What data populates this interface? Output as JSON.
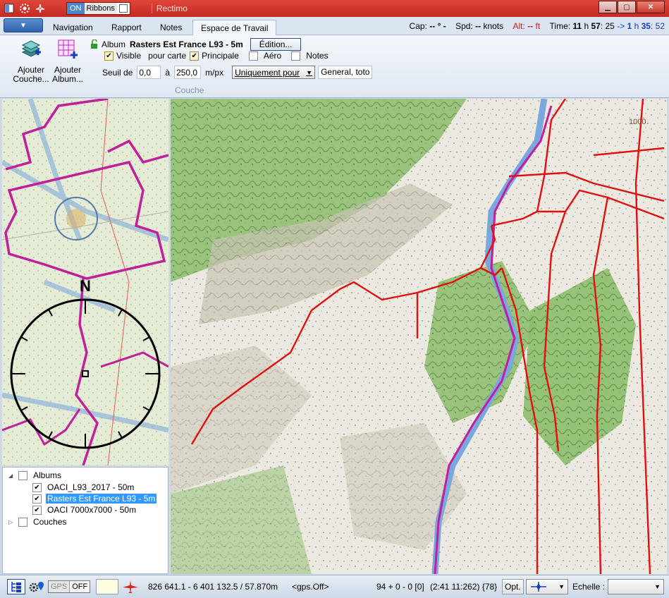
{
  "window": {
    "title": "Rectimo",
    "ribbons_toggle": {
      "on_label": "ON",
      "label": "Ribbons"
    }
  },
  "tabs": [
    {
      "label": "Navigation",
      "active": false
    },
    {
      "label": "Rapport",
      "active": false
    },
    {
      "label": "Notes",
      "active": false
    },
    {
      "label": "Espace de Travail",
      "active": true
    }
  ],
  "status_top": {
    "cap_label": "Cap:",
    "cap_value": "-- ° -",
    "spd_label": "Spd:",
    "spd_value": "--",
    "spd_unit": "knots",
    "alt_label": "Alt:",
    "alt_value": "--",
    "alt_unit": "ft",
    "time_label": "Time:",
    "time_h": "11",
    "time_h_unit": "h",
    "time_m": "57",
    "time_s": ": 25",
    "arrow": "->",
    "time2_h": "1",
    "time2_h_unit": "h",
    "time2_m": "35",
    "time2_s": ": 52"
  },
  "ribbon": {
    "add_layer": "Ajouter Couche...",
    "add_album": "Ajouter Album...",
    "album_label": "Album",
    "album_name": "Rasters Est France L93 - 5m",
    "edit_button": "Édition...",
    "visible_label": "Visible",
    "visible_checked": true,
    "pour_carte_label": "pour carte",
    "principale_label": "Principale",
    "principale_checked": true,
    "aero_label": "Aéro",
    "aero_checked": false,
    "notes_label": "Notes",
    "notes_checked": false,
    "seuil_label": "Seuil de",
    "seuil_min": "0,0",
    "a_label": "à",
    "seuil_max": "250,0",
    "unit": "m/px",
    "mode_select": "Uniquement pour",
    "mode_field": "General, toto",
    "group_label": "Couche"
  },
  "layers": {
    "albums_label": "Albums",
    "items": [
      {
        "label": "OACI_L93_2017 - 50m",
        "checked": true,
        "selected": false
      },
      {
        "label": "Rasters Est France L93 - 5m",
        "checked": true,
        "selected": true
      },
      {
        "label": "OACI 7000x7000 - 50m",
        "checked": true,
        "selected": false
      }
    ],
    "couches_label": "Couches"
  },
  "compass": {
    "north": "N"
  },
  "map": {
    "elevation_label": "1000"
  },
  "statusbar": {
    "gps_label": "GPS",
    "gps_state": "OFF",
    "coordinates": "826 641.1 - 6 401 132.5 / 57.870m",
    "gps_status": "<gps.Off>",
    "counter": "94 + 0 - 0 [0]",
    "tile_info": "(2:41  11:262) {78}",
    "opt_label": "Opt.",
    "echelle_label": "Echelle :"
  },
  "colors": {
    "titlebar": "#d0342a",
    "accent": "#3399ff",
    "route_red": "#e01010",
    "route_magenta": "#c0209a",
    "river": "#7aa8de"
  }
}
